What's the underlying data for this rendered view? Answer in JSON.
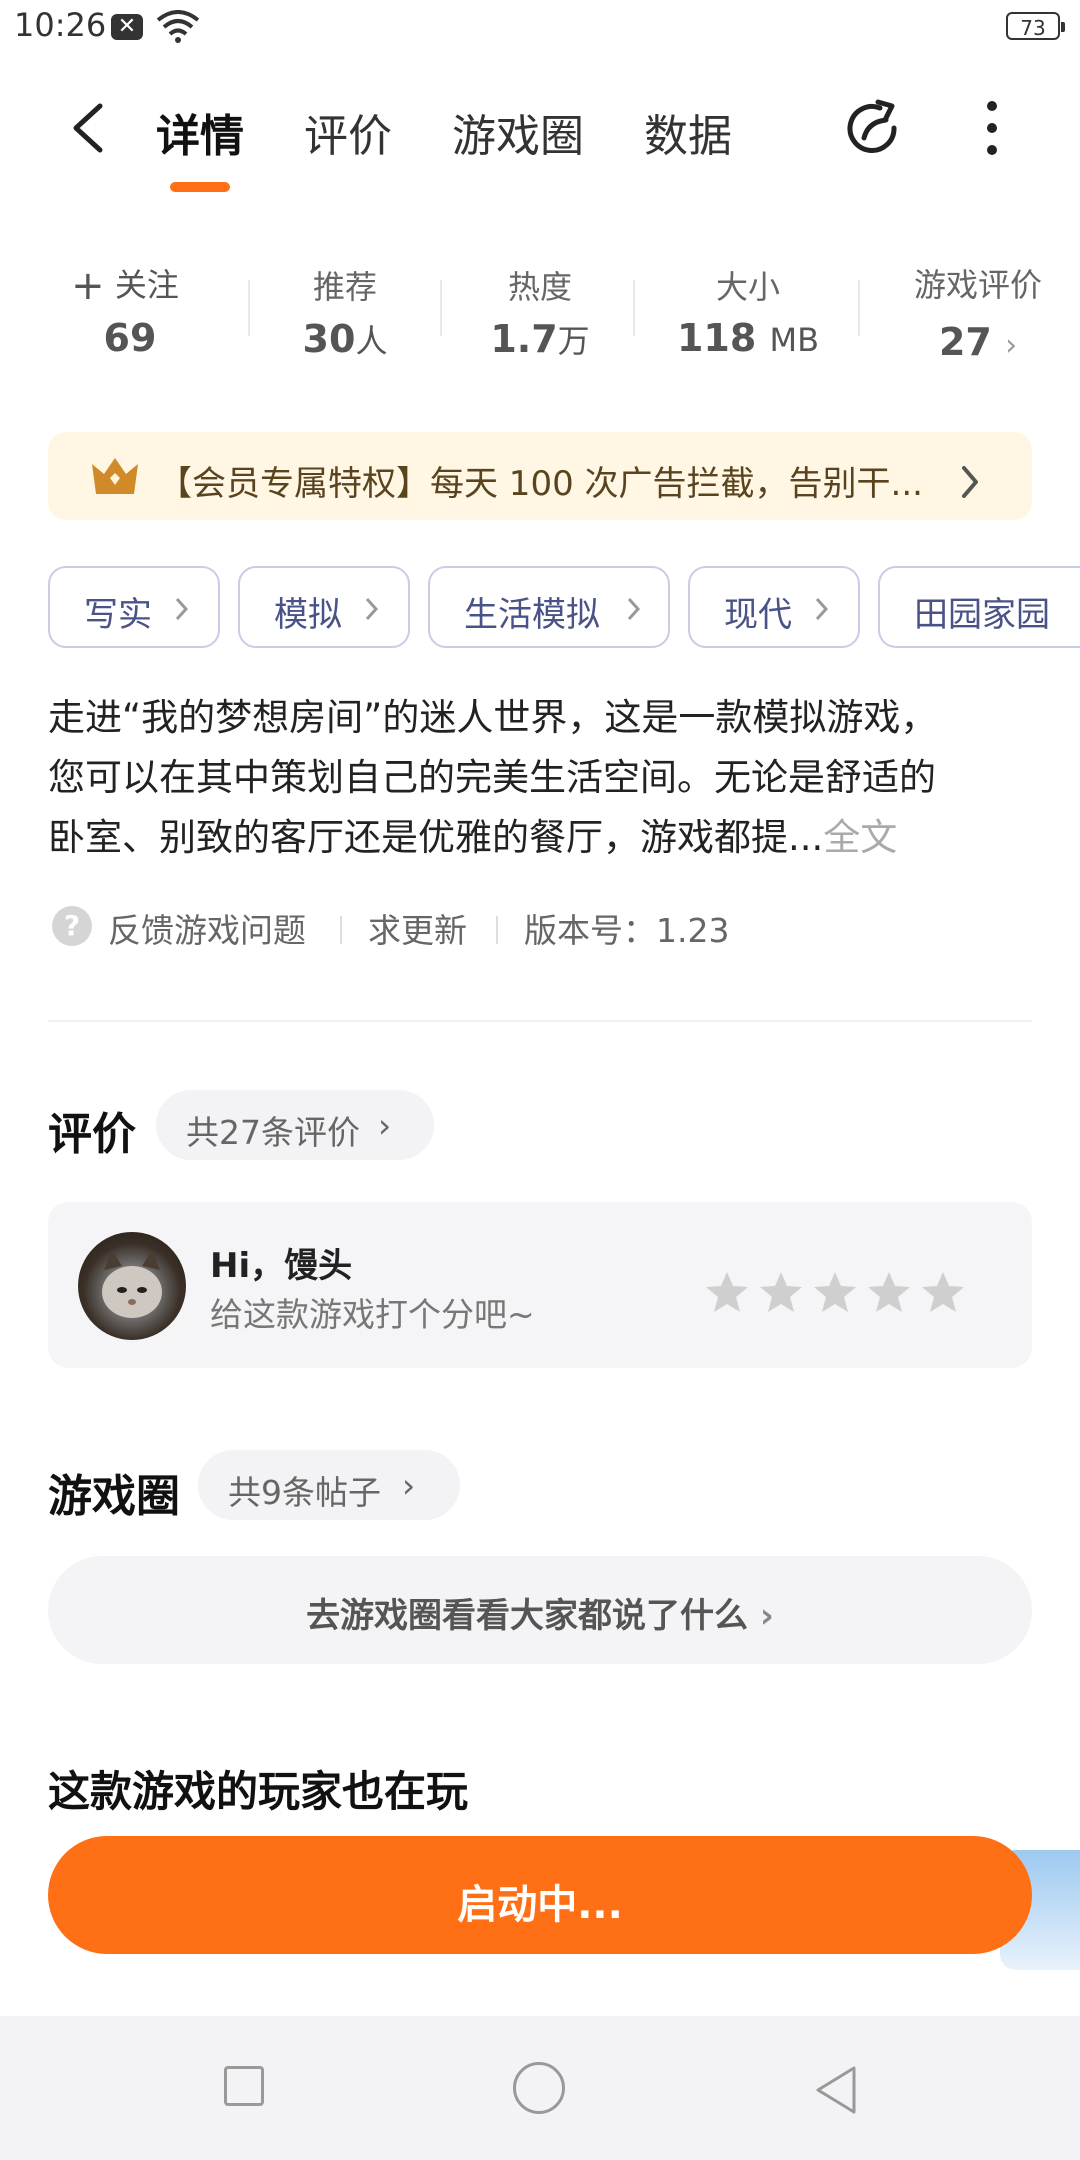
{
  "status_bar": {
    "time": "10:26",
    "battery": "73"
  },
  "nav": {
    "tabs": [
      {
        "label": "详情",
        "active": true
      },
      {
        "label": "评价",
        "active": false
      },
      {
        "label": "游戏圈",
        "active": false
      },
      {
        "label": "数据",
        "active": false
      }
    ],
    "accent_color": "#FF6F15"
  },
  "stats": {
    "follow": {
      "label": "关注",
      "value": "69"
    },
    "recommend": {
      "label": "推荐",
      "value": "30",
      "unit": "人"
    },
    "heat": {
      "label": "热度",
      "value": "1.7",
      "unit": "万"
    },
    "size": {
      "label": "大小",
      "value": "118",
      "unit": "MB"
    },
    "rating": {
      "label": "游戏评价",
      "value": "27"
    }
  },
  "banner": {
    "text": "【会员专属特权】每天 100 次广告拦截，告别干..."
  },
  "tags": [
    "写实",
    "模拟",
    "生活模拟",
    "现代",
    "田园家园"
  ],
  "description": {
    "line1": "走进“我的梦想房间”的迷人世界，这是一款模拟游戏，",
    "line2": "您可以在其中策划自己的完美生活空间。无论是舒适的",
    "line3": "卧室、别致的客厅还是优雅的餐厅，游戏都提...",
    "more": "全文"
  },
  "meta": {
    "feedback": "反馈游戏问题",
    "update": "求更新",
    "version": "版本号：1.23"
  },
  "reviews": {
    "title": "评价",
    "count_label": "共27条评价",
    "greeting": "Hi，馒头",
    "hint": "给这款游戏打个分吧~",
    "stars": 0
  },
  "circle": {
    "title": "游戏圈",
    "count_label": "共9条帖子",
    "button": "去游戏圈看看大家都说了什么"
  },
  "players_section": {
    "title": "这款游戏的玩家也在玩"
  },
  "launch": {
    "label": "启动中..."
  }
}
